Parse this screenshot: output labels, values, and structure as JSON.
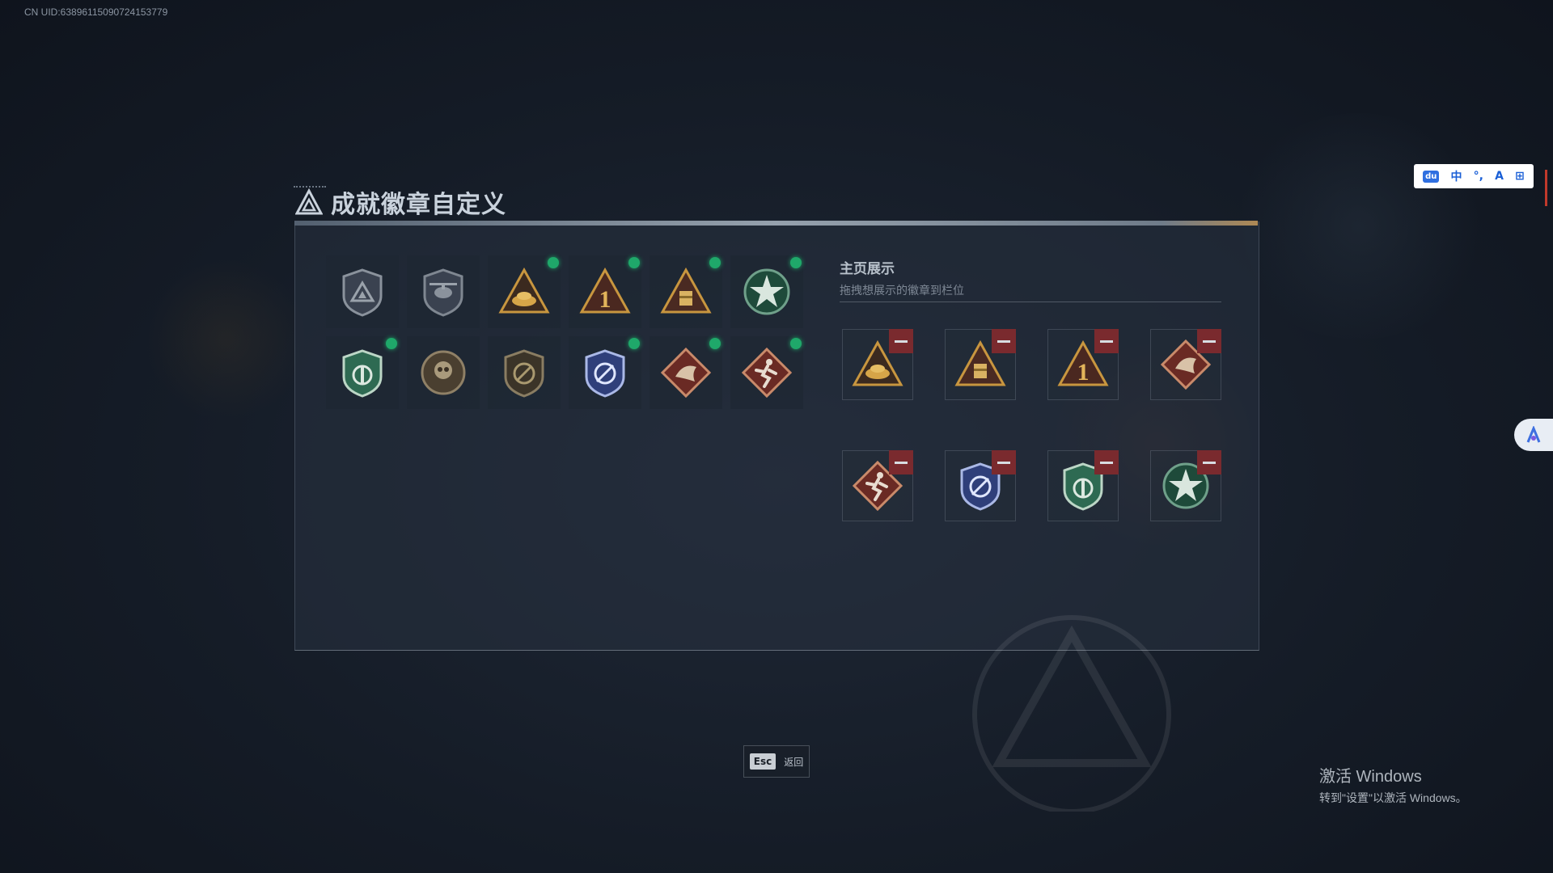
{
  "uid_label": "CN UID:638961150907241537​79",
  "title": "成就徽章自定义",
  "showcase": {
    "title": "主页展示",
    "subtitle": "拖拽想展示的徽章到栏位"
  },
  "badges": [
    {
      "icon": "triangle-shield-badge-icon",
      "unlocked": false
    },
    {
      "icon": "helicopter-shield-badge-icon",
      "unlocked": false
    },
    {
      "icon": "gold-pile-triangle-badge-icon",
      "unlocked": true
    },
    {
      "icon": "number-one-triangle-badge-icon",
      "unlocked": true
    },
    {
      "icon": "supply-crate-triangle-badge-icon",
      "unlocked": true
    },
    {
      "icon": "green-star-emblem-badge-icon",
      "unlocked": true
    },
    {
      "icon": "green-shield-badge-icon",
      "unlocked": true
    },
    {
      "icon": "skull-medallion-badge-icon",
      "unlocked": false
    },
    {
      "icon": "no-entry-shield-badge-icon",
      "unlocked": false
    },
    {
      "icon": "blue-crest-badge-icon",
      "unlocked": true
    },
    {
      "icon": "dragon-diamond-badge-icon",
      "unlocked": true
    },
    {
      "icon": "runner-diamond-badge-icon",
      "unlocked": true
    }
  ],
  "showcase_slots": [
    {
      "icon": "gold-pile-triangle-badge-icon"
    },
    {
      "icon": "supply-crate-triangle-badge-icon"
    },
    {
      "icon": "number-one-triangle-badge-icon"
    },
    {
      "icon": "dragon-diamond-badge-icon"
    },
    {
      "icon": "runner-diamond-badge-icon"
    },
    {
      "icon": "blue-crest-badge-icon"
    },
    {
      "icon": "green-shield-badge-icon"
    },
    {
      "icon": "green-star-emblem-badge-icon"
    }
  ],
  "esc": {
    "key": "Esc",
    "label": "返回"
  },
  "ime": {
    "logo": "du",
    "mode": "中",
    "punct": "°,",
    "skin": "A",
    "grid": "⊞"
  },
  "windows_activation": {
    "title": "激活 Windows",
    "subtitle": "转到\"设置\"以激活 Windows。"
  },
  "colors": {
    "unlocked_dot": "#1fa86a",
    "remove_button": "#7a2a2e",
    "background": "#151c27"
  }
}
